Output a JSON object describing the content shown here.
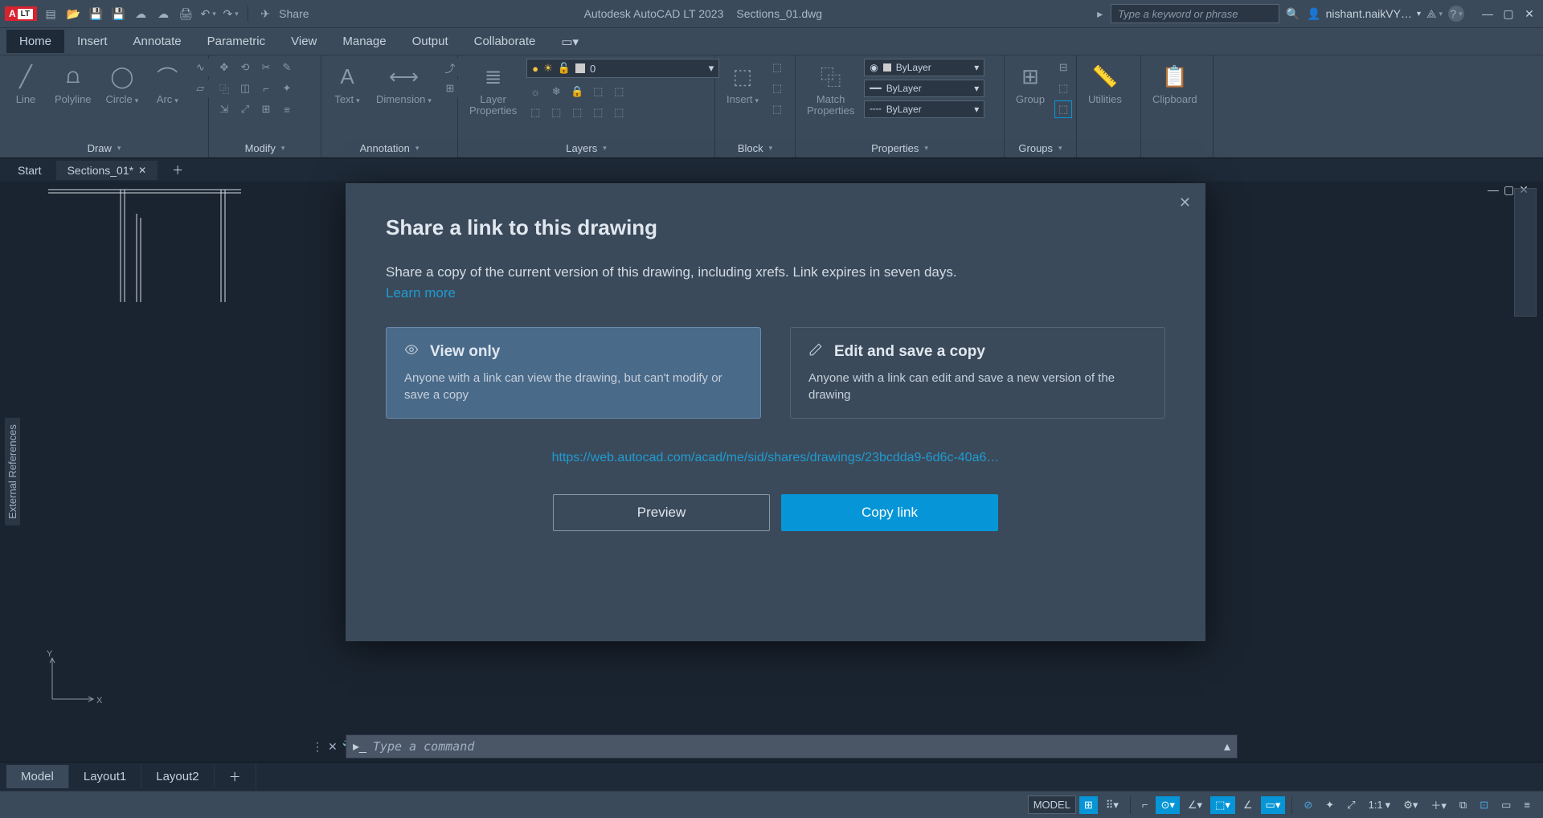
{
  "app": {
    "title": "Autodesk AutoCAD LT 2023",
    "doc": "Sections_01.dwg",
    "badge": "A",
    "lt": "LT",
    "share_label": "Share",
    "search_placeholder": "Type a keyword or phrase",
    "user": "nishant.naikVY…"
  },
  "menu": {
    "items": [
      "Home",
      "Insert",
      "Annotate",
      "Parametric",
      "View",
      "Manage",
      "Output",
      "Collaborate"
    ],
    "active": "Home"
  },
  "ribbon": {
    "draw": {
      "title": "Draw",
      "tools": [
        "Line",
        "Polyline",
        "Circle",
        "Arc"
      ]
    },
    "modify": {
      "title": "Modify"
    },
    "annotation": {
      "title": "Annotation",
      "text": "Text",
      "dim": "Dimension"
    },
    "layers": {
      "title": "Layers",
      "lp": "Layer\nProperties",
      "current": "0"
    },
    "block": {
      "title": "Block",
      "insert": "Insert"
    },
    "properties": {
      "title": "Properties",
      "match": "Match\nProperties",
      "bylayer": "ByLayer"
    },
    "groups": {
      "title": "Groups",
      "group": "Group"
    },
    "utilities": {
      "title": "Utilities"
    },
    "clipboard": {
      "title": "Clipboard"
    }
  },
  "tabs": {
    "start": "Start",
    "file": "Sections_01*"
  },
  "side_panel": "External References",
  "modal": {
    "title": "Share a link to this drawing",
    "desc": "Share a copy of the current version of this drawing, including xrefs. Link expires in seven days.",
    "learn": "Learn more",
    "opt1_title": "View only",
    "opt1_sub": "Anyone with a link can view the drawing, but can't modify or save a copy",
    "opt2_title": "Edit and save a copy",
    "opt2_sub": "Anyone with a link can edit and save a new version of the drawing",
    "url": "https://web.autocad.com/acad/me/sid/shares/drawings/23bcdda9-6d6c-40a6…",
    "preview": "Preview",
    "copy": "Copy link"
  },
  "cmd": {
    "placeholder": "Type a command"
  },
  "layouts": {
    "items": [
      "Model",
      "Layout1",
      "Layout2"
    ],
    "active": "Model"
  },
  "status": {
    "model": "MODEL",
    "scale": "1:1"
  }
}
